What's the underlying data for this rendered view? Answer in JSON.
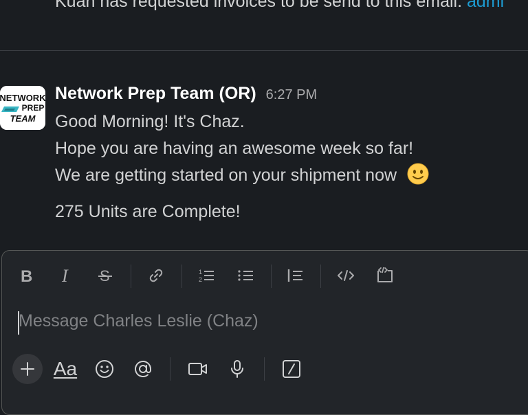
{
  "previous_message": {
    "text": "Kuan has requested invoices to be send to this email. ",
    "link": "admi"
  },
  "message": {
    "avatar": {
      "line1": "NETWORK",
      "line2": "PREP",
      "line3": "TEAM"
    },
    "sender": "Network Prep Team (OR)",
    "time": "6:27 PM",
    "lines": [
      "Good Morning! It's Chaz.",
      "Hope you are having an awesome week so far!",
      "We are getting started on your shipment now"
    ],
    "emoji": "slightly-smiling-face",
    "followup": "275 Units are Complete!"
  },
  "composer": {
    "placeholder": "Message Charles Leslie (Chaz)",
    "format_label": "Aa"
  },
  "colors": {
    "background": "#1a1d21",
    "link": "#1d9bd1",
    "composer_bg": "#222529",
    "text": "#d1d2d3"
  }
}
